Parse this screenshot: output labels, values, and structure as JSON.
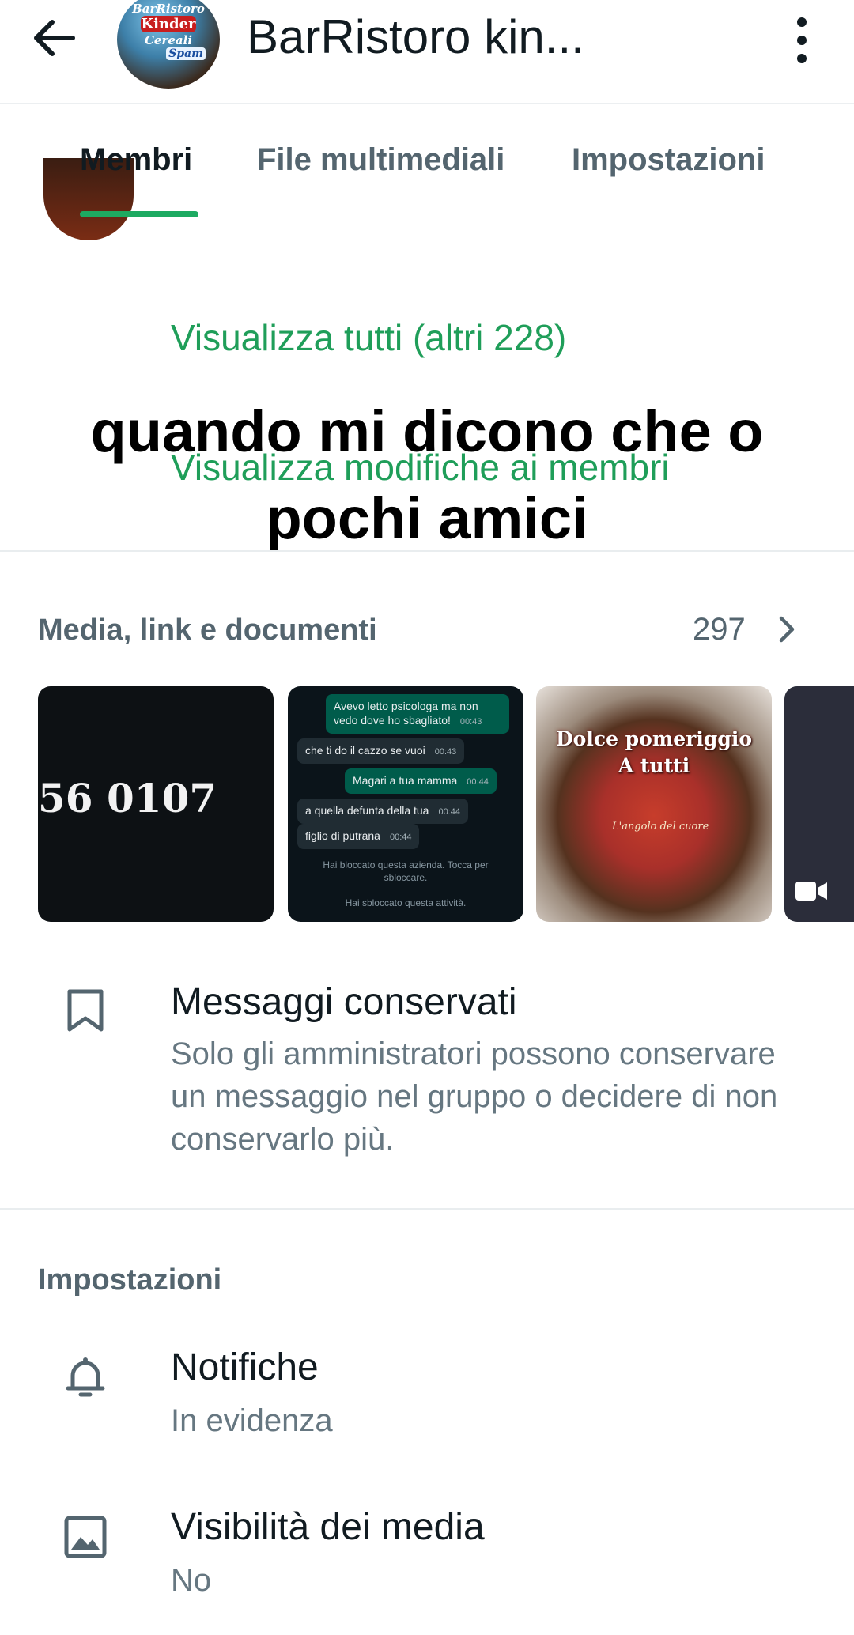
{
  "header": {
    "title": "BarRistoro kin...",
    "avatar_lines": [
      "BarRistoro",
      "Kinder",
      "Cereali",
      "Spam"
    ]
  },
  "tabs": [
    {
      "label": "Membri",
      "active": true
    },
    {
      "label": "File multimediali",
      "active": false
    },
    {
      "label": "Impostazioni",
      "active": false
    }
  ],
  "members": {
    "view_all": "Visualizza tutti (altri 228)",
    "view_changes": "Visualizza modifiche ai membri"
  },
  "overlay_caption": [
    "quando mi dicono che o",
    "pochi amici"
  ],
  "media": {
    "label": "Media, link e documenti",
    "count": "297",
    "thumb1_text": "56 0107",
    "chat": [
      {
        "text": "Avevo letto psicologa ma non vedo dove ho sbagliato!",
        "time": "00:43",
        "dir": "out"
      },
      {
        "text": "che ti do il cazzo se vuoi",
        "time": "00:43",
        "dir": "in"
      },
      {
        "text": "Magari a tua mamma",
        "time": "00:44",
        "dir": "out"
      },
      {
        "text": "a quella defunta della tua",
        "time": "00:44",
        "dir": "in"
      },
      {
        "text": "figlio di putrana",
        "time": "00:44",
        "dir": "in"
      }
    ],
    "chat_system": [
      "Hai bloccato questa azienda. Tocca per sbloccare.",
      "Hai sbloccato questa attività."
    ],
    "thumb3_text": [
      "Dolce pomeriggio",
      "A tutti"
    ],
    "thumb3_signature": "L'angolo del cuore"
  },
  "kept_messages": {
    "title": "Messaggi conservati",
    "description": "Solo gli amministratori possono conservare un messaggio nel gruppo o decidere di non conservarlo più."
  },
  "settings": {
    "label": "Impostazioni",
    "items": [
      {
        "title": "Notifiche",
        "value": "In evidenza",
        "icon": "bell-icon"
      },
      {
        "title": "Visibilità dei media",
        "value": "No",
        "icon": "image-icon"
      }
    ]
  },
  "colors": {
    "accent_green": "#1daa61",
    "link_green": "#1f9e59",
    "text_primary": "#111b21",
    "text_secondary": "#667781"
  }
}
